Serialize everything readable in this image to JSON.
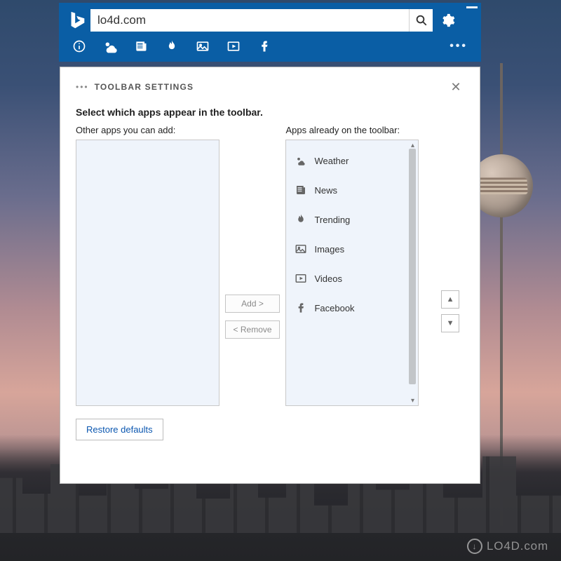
{
  "search": {
    "value": "lo4d.com"
  },
  "toolbar": {
    "icons": [
      "info",
      "weather",
      "news",
      "trending",
      "images",
      "videos",
      "facebook"
    ]
  },
  "settings": {
    "title": "TOOLBAR SETTINGS",
    "instruction": "Select which apps appear in the toolbar.",
    "leftLabel": "Other apps you can add:",
    "rightLabel": "Apps already on the toolbar:",
    "addLabel": "Add >",
    "removeLabel": "< Remove",
    "restoreLabel": "Restore defaults",
    "apps": [
      {
        "icon": "weather",
        "label": "Weather"
      },
      {
        "icon": "news",
        "label": "News"
      },
      {
        "icon": "trending",
        "label": "Trending"
      },
      {
        "icon": "images",
        "label": "Images"
      },
      {
        "icon": "videos",
        "label": "Videos"
      },
      {
        "icon": "facebook",
        "label": "Facebook"
      }
    ]
  },
  "watermark": "LO4D.com"
}
